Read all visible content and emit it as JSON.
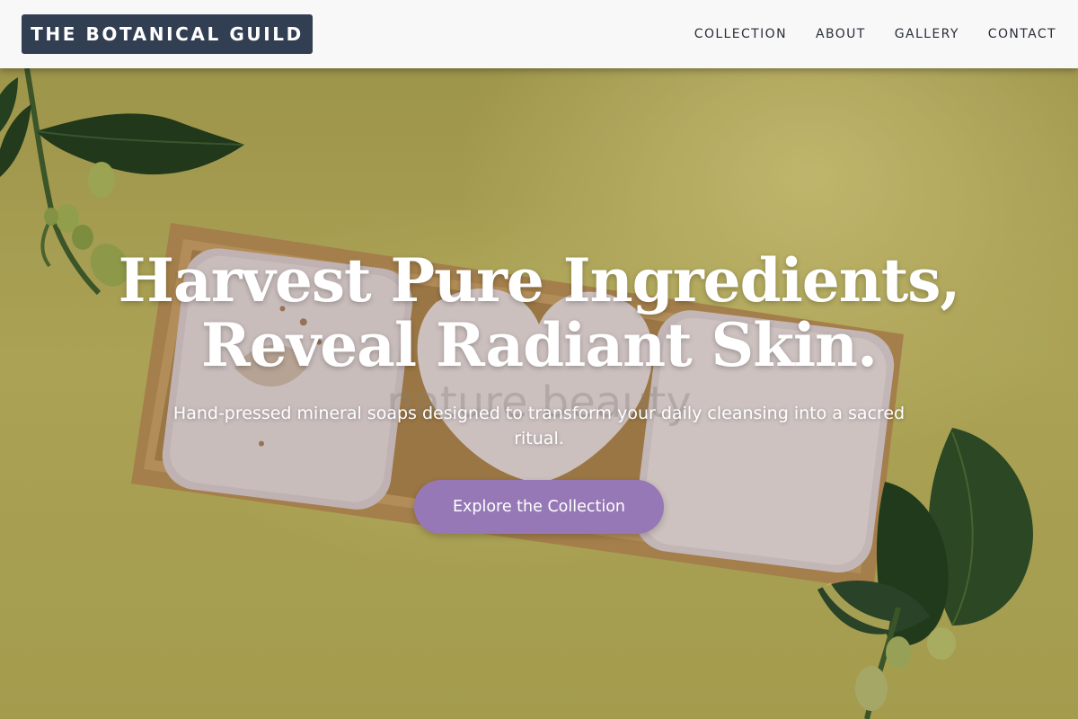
{
  "header": {
    "brand": "THE BOTANICAL GUILD",
    "nav": [
      {
        "label": "COLLECTION"
      },
      {
        "label": "ABOUT"
      },
      {
        "label": "GALLERY"
      },
      {
        "label": "CONTACT"
      }
    ]
  },
  "hero": {
    "headline_line1": "Harvest Pure Ingredients,",
    "headline_line2": "Reveal Radiant Skin.",
    "subtitle": "Hand-pressed mineral soaps designed to transform your daily cleansing into a sacred ritual.",
    "cta_label": "Explore the Collection",
    "image_text": "nature beauty"
  },
  "colors": {
    "header_bg": "#f8f8f8",
    "brand_bg": "#323e52",
    "cta_bg": "#9778b6",
    "hero_bg": "#b9ad58"
  }
}
